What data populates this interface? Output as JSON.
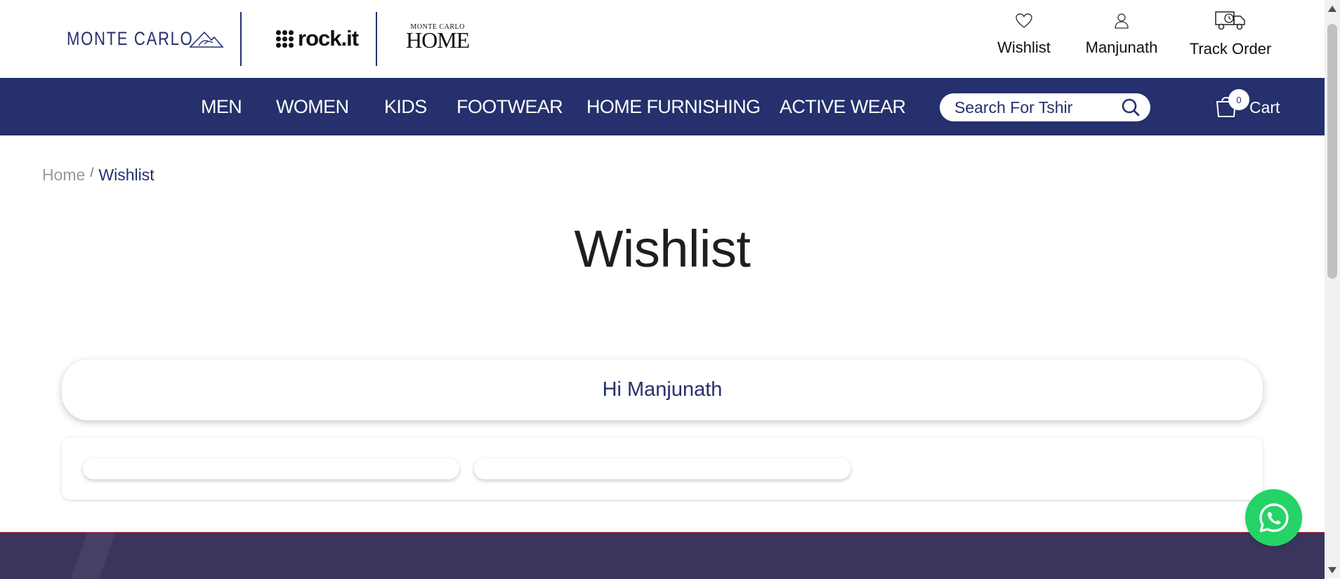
{
  "header": {
    "brands": {
      "monte_carlo": "MONTE CARLO",
      "rockit": "rock.it",
      "home_small": "MONTE CARLO",
      "home_big": "HOME"
    },
    "links": [
      {
        "label": "Wishlist",
        "icon": "heart-icon"
      },
      {
        "label": "Manjunath",
        "icon": "user-icon"
      },
      {
        "label": "Track Order",
        "icon": "truck-icon"
      }
    ]
  },
  "nav": {
    "items": [
      "MEN",
      "WOMEN",
      "KIDS",
      "FOOTWEAR",
      "HOME FURNISHING",
      "ACTIVE WEAR"
    ],
    "search": {
      "placeholder": "Search For Tshir",
      "icon": "search-icon"
    },
    "cart": {
      "label": "Cart",
      "count": "0",
      "icon": "shopping-bag-icon"
    }
  },
  "breadcrumb": {
    "home": "Home",
    "separator": "/",
    "current": "Wishlist"
  },
  "page": {
    "title": "Wishlist",
    "greeting": "Hi Manjunath"
  },
  "floating": {
    "icon": "whatsapp-icon"
  },
  "colors": {
    "brand_navy": "#25306c",
    "footer": "#3b355e",
    "whatsapp": "#25d366"
  }
}
